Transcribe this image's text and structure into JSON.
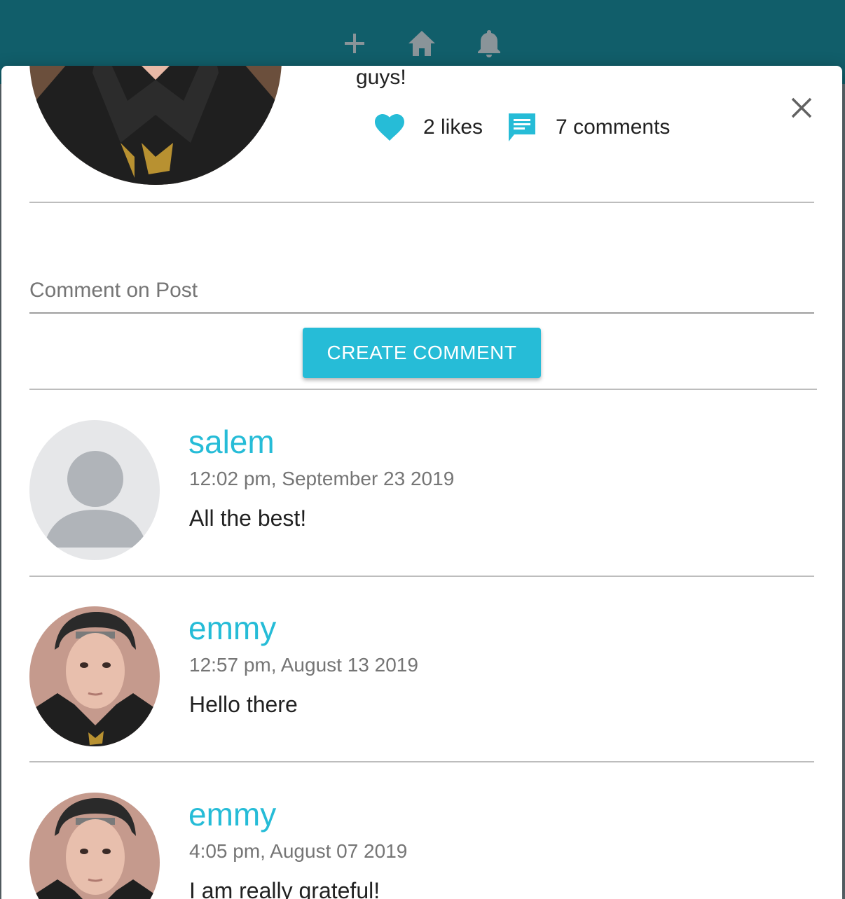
{
  "appbar": {
    "icons": [
      "add-icon",
      "home-icon",
      "bell-icon"
    ],
    "color": "#115e6a"
  },
  "post": {
    "text_fragment": "guys!",
    "likes_label": "2 likes",
    "comments_label": "7 comments"
  },
  "comment_form": {
    "placeholder": "Comment on Post",
    "value": "",
    "submit_label": "CREATE COMMENT"
  },
  "comments": [
    {
      "name": "salem",
      "time": "12:02 pm, September 23 2019",
      "text": "All the best!",
      "avatar": "default-avatar"
    },
    {
      "name": "emmy",
      "time": "12:57 pm, August 13 2019",
      "text": "Hello there",
      "avatar": "user-photo"
    },
    {
      "name": "emmy",
      "time": "4:05 pm, August 07 2019",
      "text": "I am really grateful!",
      "avatar": "user-photo"
    }
  ],
  "colors": {
    "accent": "#26bcd7",
    "text": "#212121",
    "muted": "#757575"
  }
}
